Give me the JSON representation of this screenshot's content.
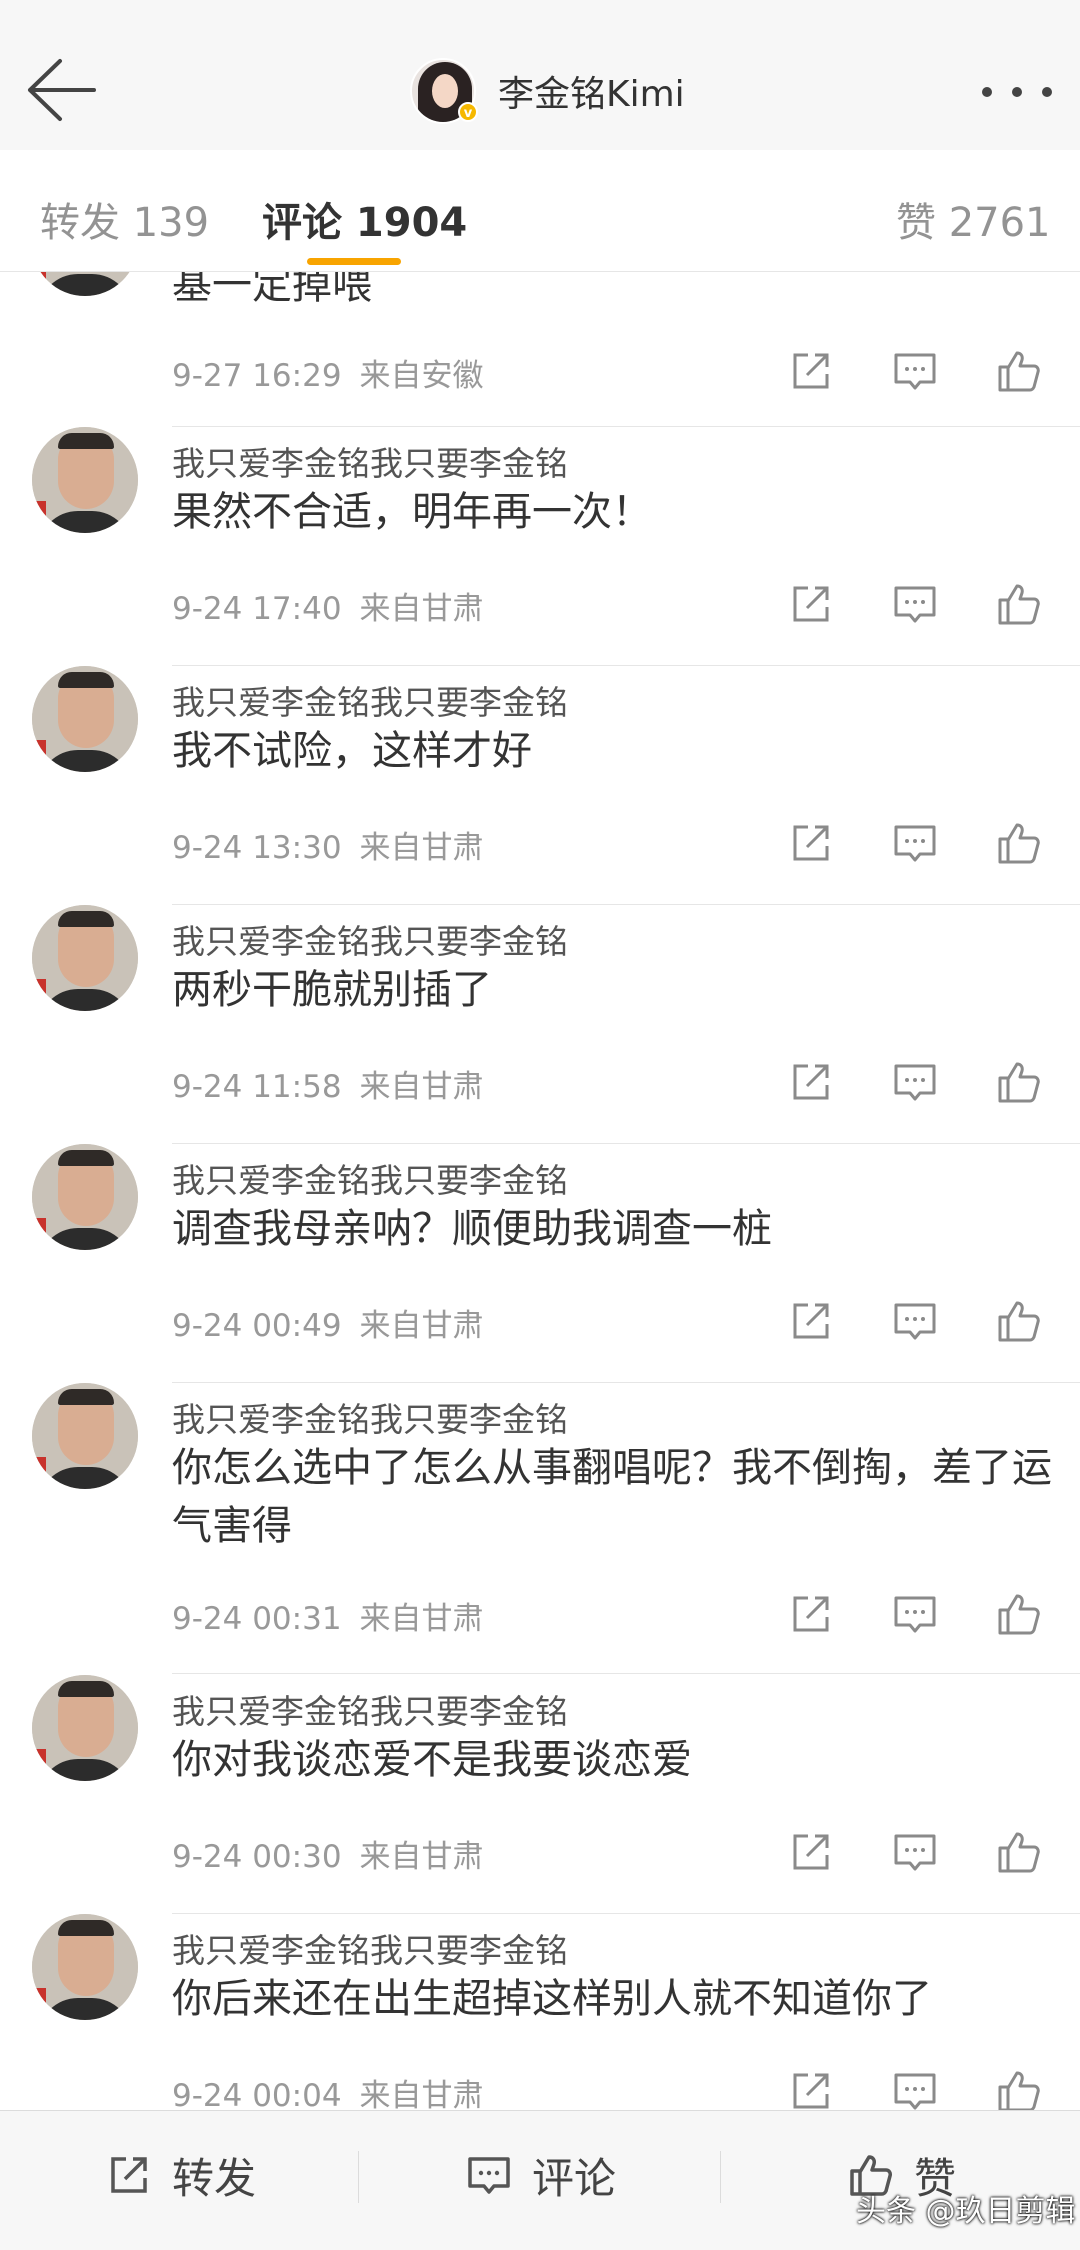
{
  "header": {
    "back_icon": "back-arrow-icon",
    "profile_name": "李金铭Kimi",
    "verified_badge": "v",
    "more_icon": "more-dots-icon"
  },
  "tabs": {
    "repost": "转发 139",
    "comment": "评论 1904",
    "like": "赞 2761",
    "active": "comment",
    "accent_color": "#f8a400"
  },
  "comments": [
    {
      "user": "",
      "text": "基一定掉喂",
      "time": "9-27 16:29",
      "source": "来自安徽"
    },
    {
      "user": "我只爱李金铭我只要李金铭",
      "text": "果然不合适，明年再一次！",
      "time": "9-24 17:40",
      "source": "来自甘肃"
    },
    {
      "user": "我只爱李金铭我只要李金铭",
      "text": "我不试险，这样才好",
      "time": "9-24 13:30",
      "source": "来自甘肃"
    },
    {
      "user": "我只爱李金铭我只要李金铭",
      "text": "两秒干脆就别插了",
      "time": "9-24 11:58",
      "source": "来自甘肃"
    },
    {
      "user": "我只爱李金铭我只要李金铭",
      "text": "调查我母亲呐？顺便助我调查一桩",
      "time": "9-24 00:49",
      "source": "来自甘肃"
    },
    {
      "user": "我只爱李金铭我只要李金铭",
      "text": "你怎么选中了怎么从事翻唱呢？我不倒掏，差了运气害得",
      "time": "9-24 00:31",
      "source": "来自甘肃"
    },
    {
      "user": "我只爱李金铭我只要李金铭",
      "text": "你对我谈恋爱不是我要谈恋爱",
      "time": "9-24 00:30",
      "source": "来自甘肃"
    },
    {
      "user": "我只爱李金铭我只要李金铭",
      "text": "你后来还在出生超掉这样别人就不知道你了",
      "time": "9-24 00:04",
      "source": "来自甘肃"
    }
  ],
  "comment_actions": {
    "share_icon": "share-icon",
    "comment_icon": "comment-icon",
    "like_icon": "thumbs-up-icon"
  },
  "bottom_bar": {
    "repost": "转发",
    "comment": "评论",
    "like": "赞"
  },
  "watermark": "头条 @玖日剪辑"
}
